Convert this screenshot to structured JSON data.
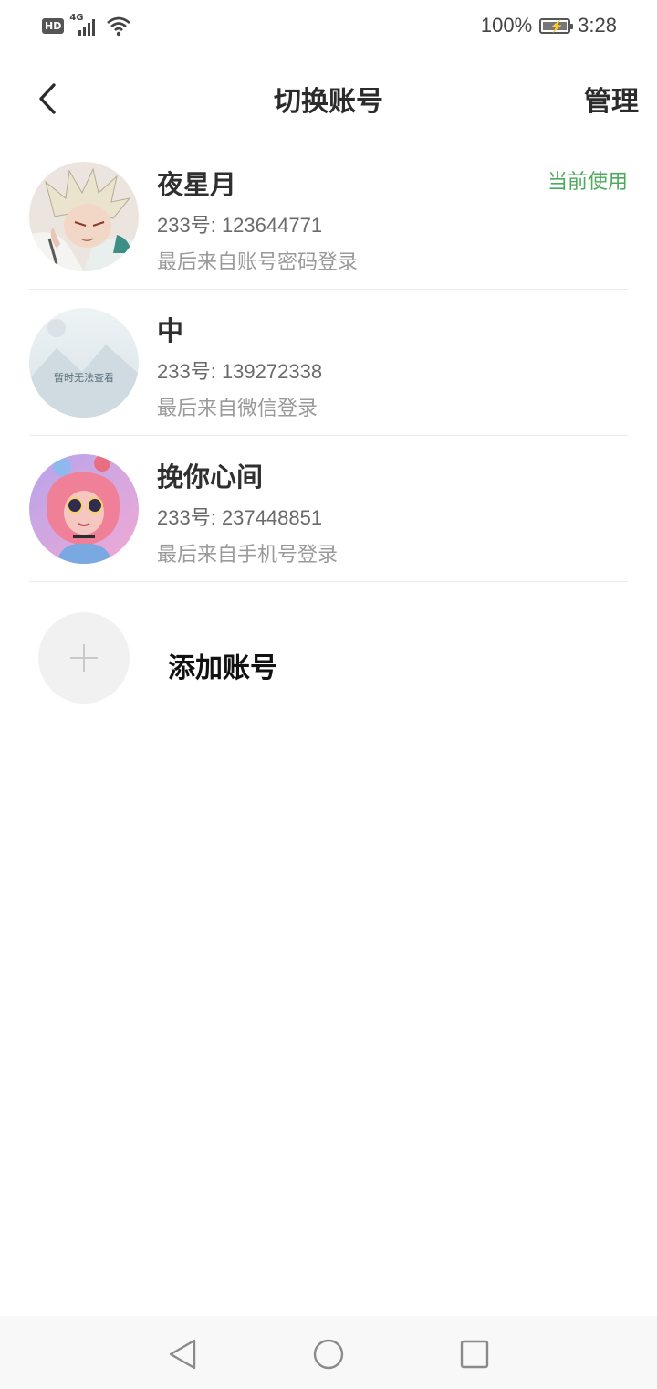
{
  "status_bar": {
    "hd_badge": "HD",
    "network": "4G",
    "battery_text": "100%",
    "time": "3:28"
  },
  "header": {
    "title": "切换账号",
    "manage_label": "管理"
  },
  "accounts": [
    {
      "name": "夜星月",
      "id_label": "233号: ",
      "id_number": "123644771",
      "login_source": "最后来自账号密码登录",
      "current_label": "当前使用"
    },
    {
      "name": "中",
      "id_label": "233号: ",
      "id_number": "139272338",
      "login_source": "最后来自微信登录",
      "placeholder_text": "暂时无法查看"
    },
    {
      "name": "挽你心间",
      "id_label": "233号: ",
      "id_number": "237448851",
      "login_source": "最后来自手机号登录"
    }
  ],
  "add_account": {
    "label": "添加账号"
  },
  "colors": {
    "current_green": "#4faa5d",
    "divider": "#ebebeb"
  }
}
